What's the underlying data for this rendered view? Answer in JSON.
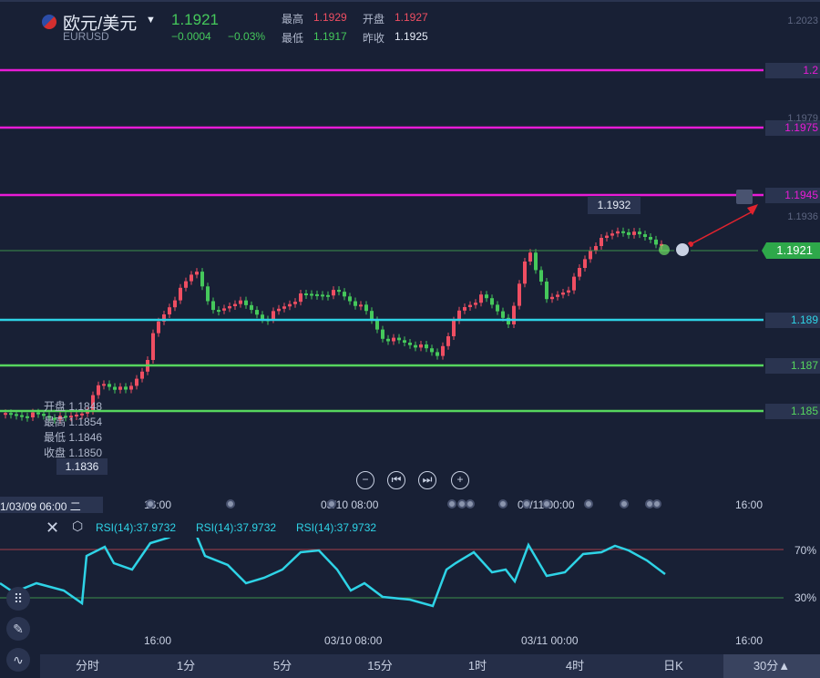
{
  "header": {
    "pair": "欧元/美元",
    "symbol": "EURUSD",
    "price": "1.1921",
    "change": "−0.0004",
    "change_pct": "−0.03%",
    "high_label": "最高",
    "high": "1.1929",
    "open_label": "开盘",
    "open": "1.1927",
    "low_label": "最低",
    "low": "1.1917",
    "prev_label": "昨收",
    "prev": "1.1925"
  },
  "price_lines": [
    {
      "label": "1.2",
      "color": "#e81bd6"
    },
    {
      "label": "1.1975",
      "color": "#e81bd6"
    },
    {
      "label": "1.1945",
      "color": "#e81bd6"
    },
    {
      "label": "1.189",
      "color": "#2ed3e6"
    },
    {
      "label": "1.187",
      "color": "#56d65e"
    },
    {
      "label": "1.185",
      "color": "#56d65e"
    }
  ],
  "axis_ticks": [
    "1.2023",
    "1.1979",
    "1.1936"
  ],
  "current_price_tag": "1.1921",
  "high_marker": "1.1932",
  "low_marker": "1.1836",
  "ohlc_tooltip": {
    "open": "开盘 1.1848",
    "high": "最高 1.1854",
    "low": "最低 1.1846",
    "close": "收盘 1.1850"
  },
  "crosshair_time": "1/03/09 06:00 二",
  "time_axis": [
    "16:00",
    "03/10 08:00",
    "03/11 00:00",
    "16:00"
  ],
  "rsi": {
    "label1": "RSI(14):37.9732",
    "label2": "RSI(14):37.9732",
    "label3": "RSI(14):37.9732",
    "upper": "70%",
    "lower": "30%"
  },
  "rsi_time_axis": [
    "16:00",
    "03/10 08:00",
    "03/11 00:00",
    "16:00"
  ],
  "timeframes": [
    "分时",
    "1分",
    "5分",
    "15分",
    "1时",
    "4时",
    "日K",
    "30分▲"
  ],
  "colors": {
    "up": "#ef4e62",
    "down": "#45c85b",
    "rsi": "#2ed3e6",
    "bg": "#182035"
  }
}
